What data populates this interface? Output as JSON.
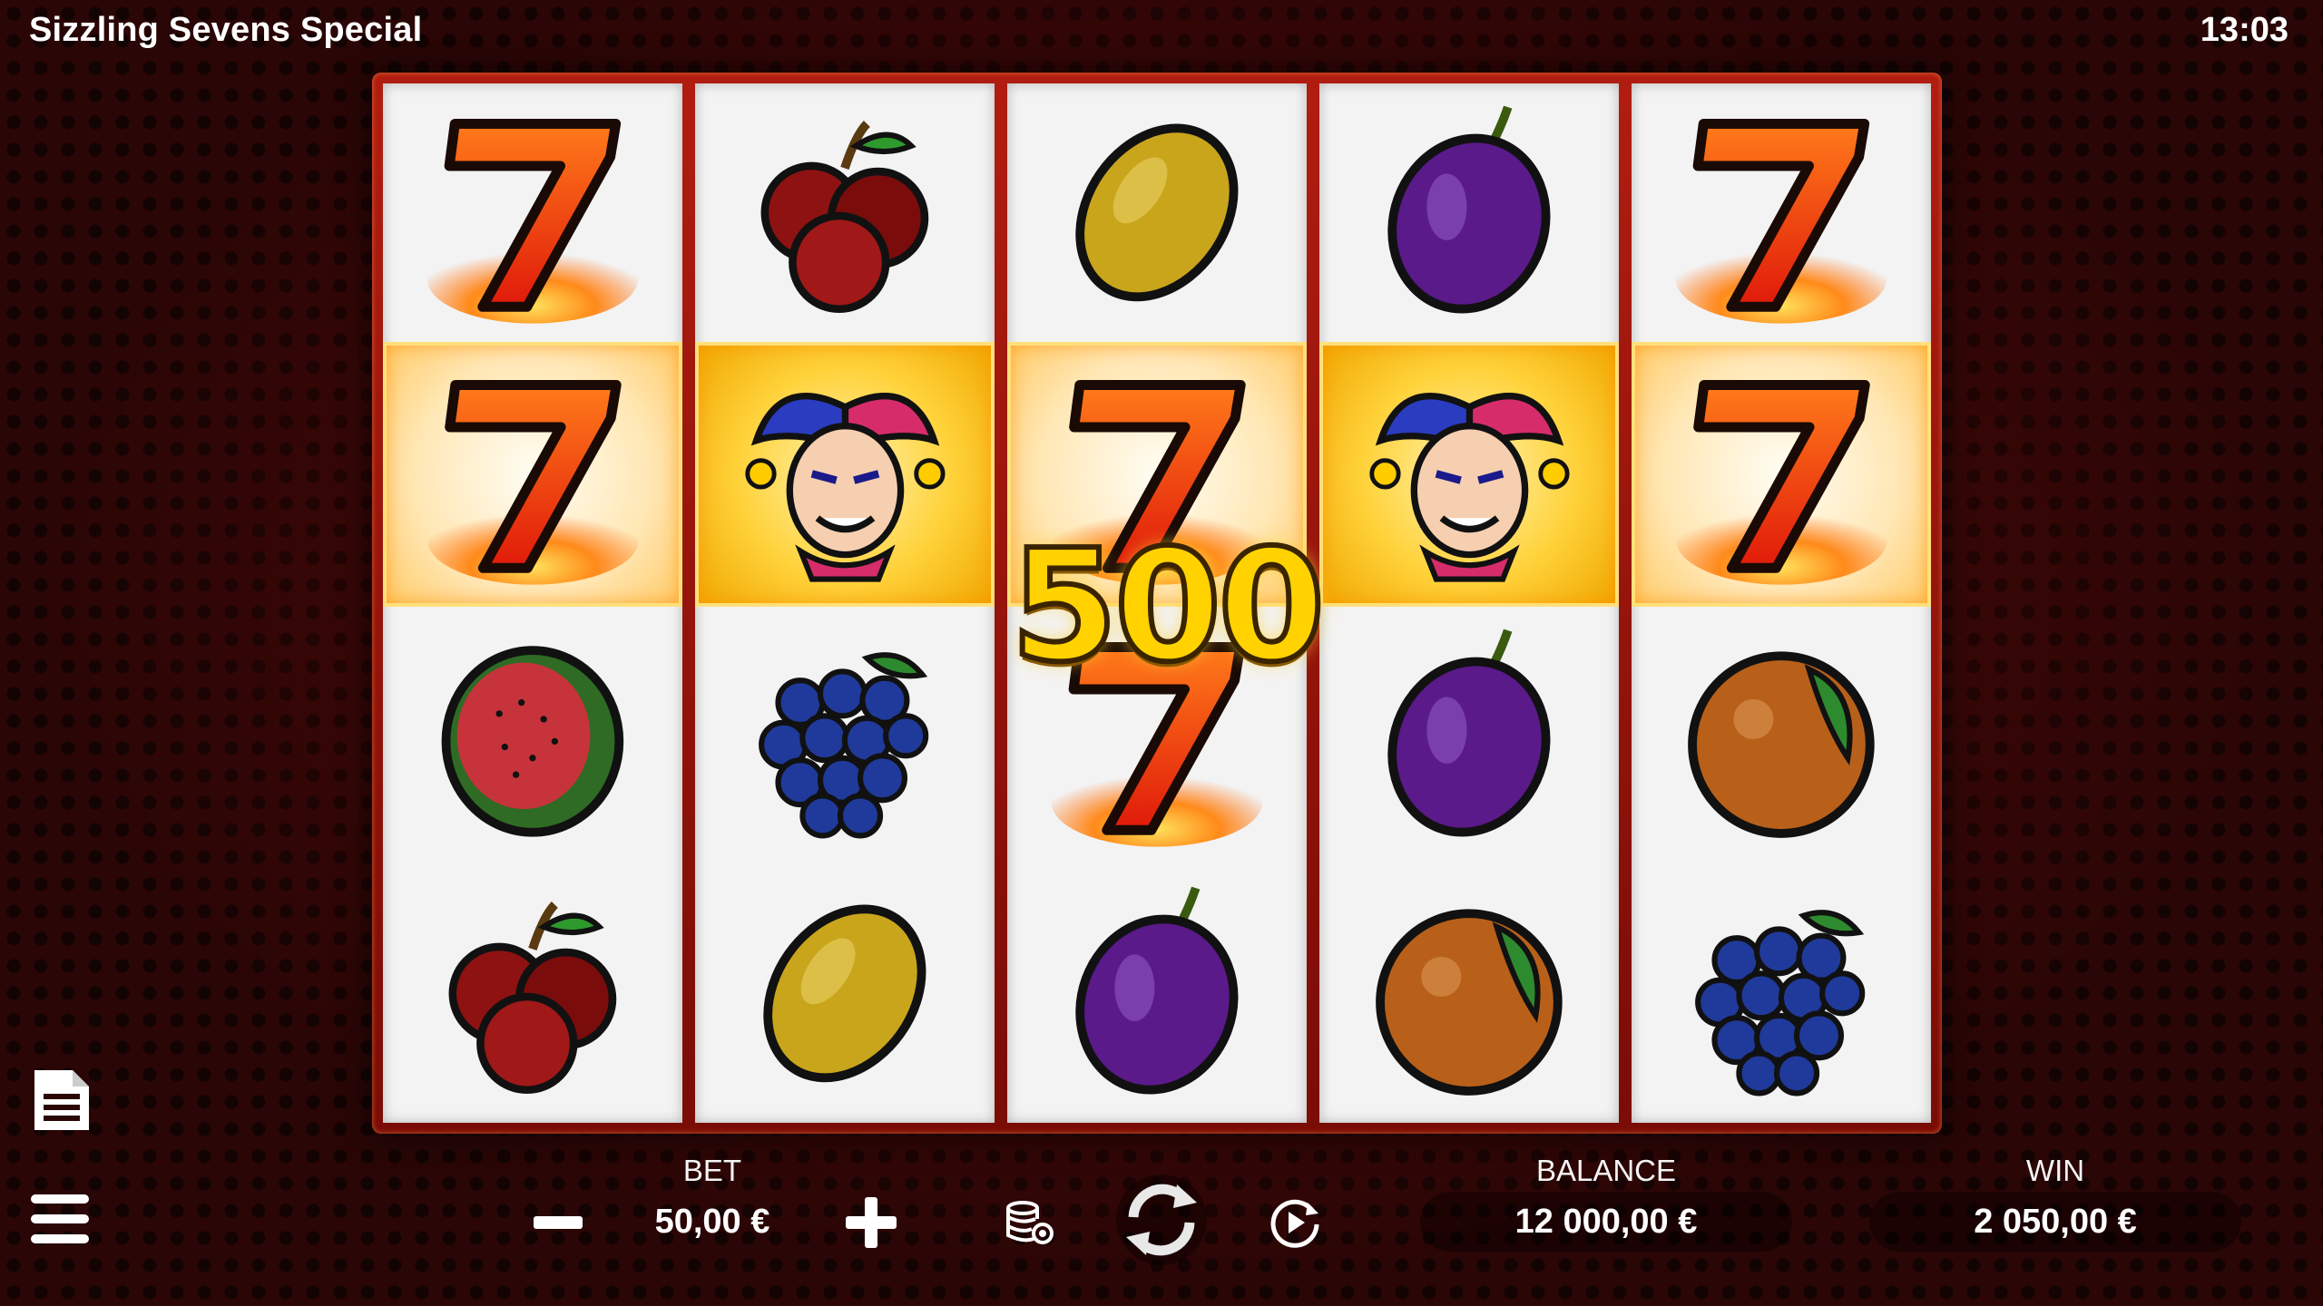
{
  "header": {
    "game_title": "Sizzling Sevens Special",
    "clock": "13:03"
  },
  "reels": [
    [
      "seven",
      "seven",
      "watermelon",
      "cherry"
    ],
    [
      "cherry",
      "joker",
      "grapes",
      "lemon"
    ],
    [
      "lemon",
      "seven",
      "seven",
      "plum"
    ],
    [
      "plum",
      "joker",
      "plum",
      "orange"
    ],
    [
      "seven",
      "seven",
      "orange",
      "grapes"
    ]
  ],
  "winning_row": 1,
  "win_display": "500",
  "controls": {
    "bet_label": "BET",
    "bet_value": "50,00 €",
    "balance_label": "BALANCE",
    "balance_value": "12 000,00 €",
    "win_label": "WIN",
    "win_value": "2 050,00 €"
  },
  "icons": {
    "paytable": "document-icon",
    "menu": "hamburger-menu-icon",
    "bet_decrease": "minus-icon",
    "bet_increase": "plus-icon",
    "bet_settings": "coins-settings-icon",
    "spin": "spin-arrows-icon",
    "autoplay": "autoplay-icon"
  },
  "colors": {
    "background": "#2a0606",
    "reel_frame": "#b11d10",
    "win_text": "#ffd200",
    "win_cell": "#ffd23a"
  }
}
